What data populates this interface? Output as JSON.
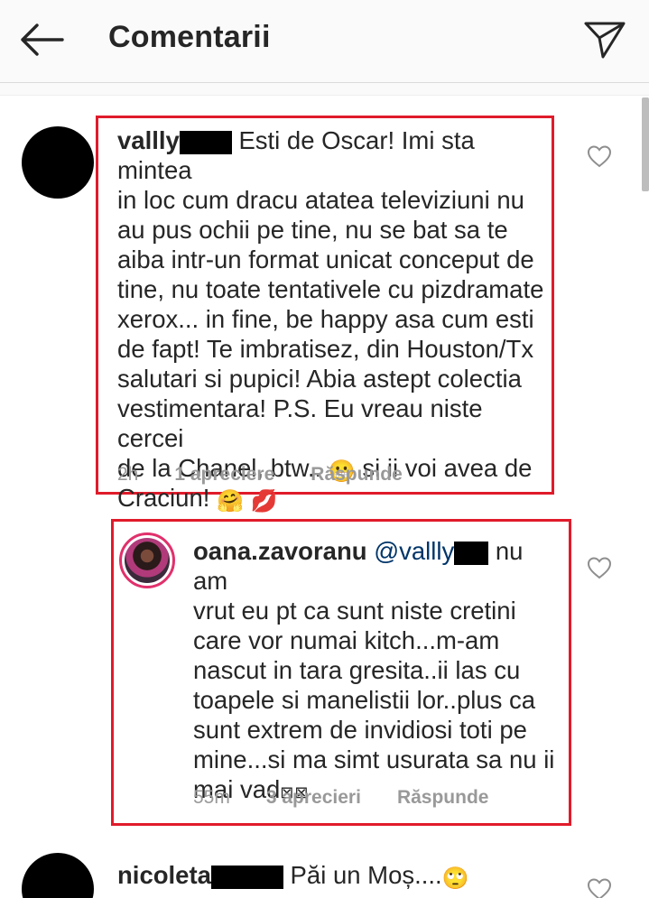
{
  "header": {
    "title": "Comentarii"
  },
  "comments": [
    {
      "username": "vallly",
      "text_lines": [
        " Esti de Oscar! Imi sta mintea",
        "in loc cum dracu atatea televiziuni nu",
        "au pus ochii pe tine, nu se bat sa te",
        "aiba intr-un format unicat conceput de",
        "tine, nu toate tentativele cu pizdramate",
        "xerox... in fine, be happy asa cum esti",
        "de fapt! Te imbratisez, din Houston/Tx",
        "salutari si pupici! Abia astept colectia",
        "vestimentara! P.S. Eu vreau niste cercei",
        "de la Chanel, btw.. ",
        " si ii voi avea de",
        "Craciun! "
      ],
      "emojis": {
        "grimace": "😬",
        "hug": "🤗",
        "kiss": "💋"
      },
      "time": "2h",
      "likes": "1 apreciere",
      "reply": "Răspunde"
    },
    {
      "username": "oana.zavoranu",
      "mention": "@vallly",
      "text_lines": [
        " nu am",
        "vrut eu pt ca sunt niste cretini",
        "care vor numai kitch...m-am",
        "nascut in tara gresita..ii las cu",
        "toapele si manelistii lor..plus ca",
        "sunt extrem de invidiosi toti pe",
        "mine...si ma simt usurata sa nu ii",
        "mai vad"
      ],
      "trailing_glyphs": "⊠⊠",
      "time": "55m",
      "likes": "3 aprecieri",
      "reply": "Răspunde"
    },
    {
      "username": "nicoleta",
      "text": " Păi un Moș....",
      "emoji": "🙄"
    }
  ],
  "colors": {
    "highlight_box": "#e01b2a",
    "meta_text": "#999999",
    "story_ring": "#e1306c"
  },
  "icons": [
    "back-arrow-icon",
    "send-icon",
    "heart-icon"
  ]
}
